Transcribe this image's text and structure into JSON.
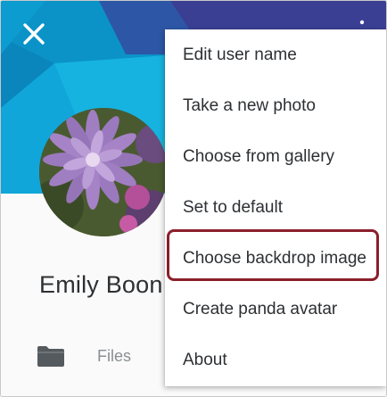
{
  "header": {
    "close_icon": "close-icon",
    "overflow_icon": "more-vertical-icon",
    "backdrop_colors": [
      "#0a8fc2",
      "#11a9dd",
      "#2458a8",
      "#3a3a8c",
      "#1bb6c9"
    ]
  },
  "profile": {
    "user_name": "Emily Boon",
    "files_label": "Files",
    "files_icon": "folder-icon"
  },
  "menu": {
    "items": [
      "Edit user name",
      "Take a new photo",
      "Choose from gallery",
      "Set to default",
      "Choose backdrop image",
      "Create panda avatar",
      "About"
    ],
    "highlighted_index": 4,
    "highlight_color": "#8b1f2b"
  }
}
